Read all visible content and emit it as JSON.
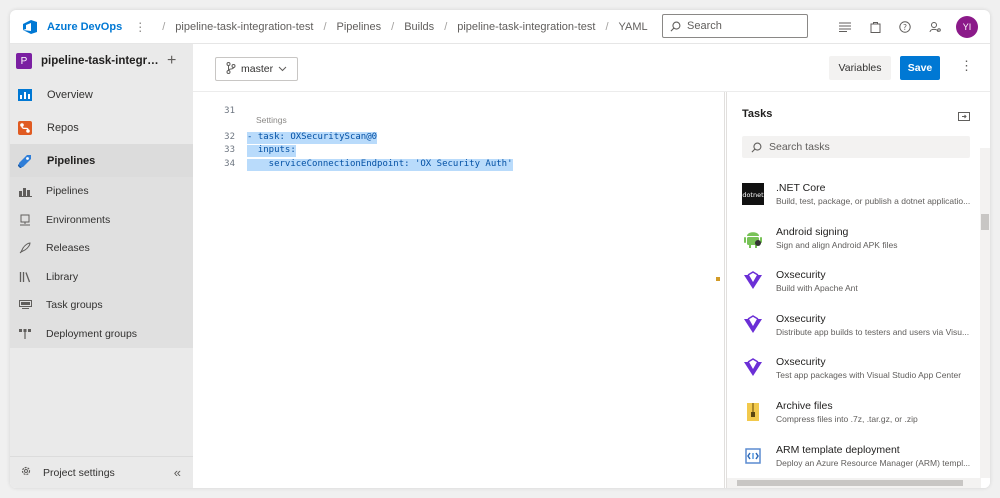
{
  "topbar": {
    "brand": "Azure DevOps",
    "breadcrumbs": [
      "pipeline-task-integration-test",
      "Pipelines",
      "Builds",
      "pipeline-task-integration-test",
      "YAML"
    ],
    "search_placeholder": "Search",
    "avatar_initials": "YI"
  },
  "sidebar": {
    "project_badge": "P",
    "project_name": "pipeline-task-integration-test",
    "items": [
      {
        "label": "Overview"
      },
      {
        "label": "Repos"
      },
      {
        "label": "Pipelines"
      }
    ],
    "sub_items": [
      {
        "label": "Pipelines"
      },
      {
        "label": "Environments"
      },
      {
        "label": "Releases"
      },
      {
        "label": "Library"
      },
      {
        "label": "Task groups"
      },
      {
        "label": "Deployment groups"
      }
    ],
    "settings_label": "Project settings"
  },
  "toolbar": {
    "branch": "master",
    "variables_label": "Variables",
    "save_label": "Save"
  },
  "editor": {
    "settings_hint": "Settings",
    "lines": [
      {
        "num": "31",
        "text": ""
      },
      {
        "num": "32",
        "text": "- task: OXSecurityScan@0"
      },
      {
        "num": "33",
        "text": "  inputs:"
      },
      {
        "num": "34",
        "text": "    serviceConnectionEndpoint: 'OX Security Auth'"
      }
    ]
  },
  "tasks_panel": {
    "title": "Tasks",
    "search_placeholder": "Search tasks",
    "items": [
      {
        "name": ".NET Core",
        "desc": "Build, test, package, or publish a dotnet applicatio...",
        "icon": "dotnet-icon"
      },
      {
        "name": "Android signing",
        "desc": "Sign and align Android APK files",
        "icon": "android-icon"
      },
      {
        "name": "Oxsecurity",
        "desc": "Build with Apache Ant",
        "icon": "oxsecurity-icon"
      },
      {
        "name": "Oxsecurity",
        "desc": "Distribute app builds to testers and users via Visu...",
        "icon": "oxsecurity-icon"
      },
      {
        "name": "Oxsecurity",
        "desc": "Test app packages with Visual Studio App Center",
        "icon": "oxsecurity-icon"
      },
      {
        "name": "Archive files",
        "desc": "Compress files into .7z, .tar.gz, or .zip",
        "icon": "archive-icon"
      },
      {
        "name": "ARM template deployment",
        "desc": "Deploy an Azure Resource Manager (ARM) templ...",
        "icon": "arm-template-icon"
      }
    ]
  },
  "colors": {
    "accent": "#0078d4",
    "avatar": "#8b1a89",
    "selection": "#b9dbfb",
    "oxsecurity": "#6b2fd6"
  }
}
